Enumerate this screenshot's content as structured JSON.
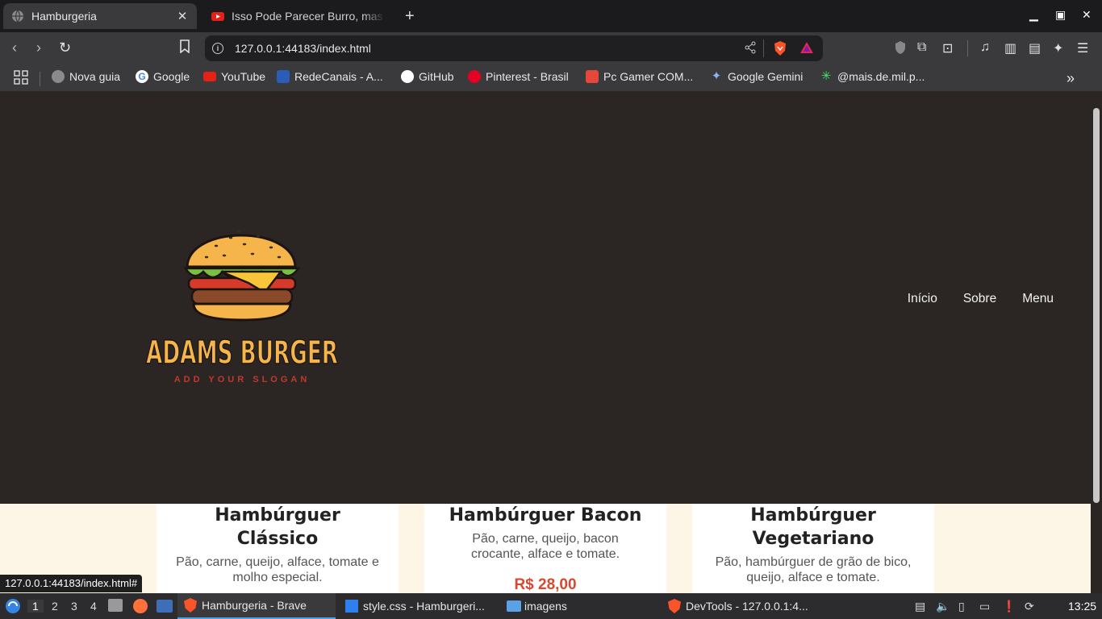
{
  "browser": {
    "tabs": [
      {
        "title": "Hamburgeria",
        "active": true
      },
      {
        "title": "Isso Pode Parecer Burro, mas v",
        "active": false
      }
    ],
    "new_tab": "+",
    "url": "127.0.0.1:44183/index.html",
    "bookmarks": [
      {
        "label": "Nova guia",
        "icon": "globe-icon"
      },
      {
        "label": "Google",
        "icon": "google-icon"
      },
      {
        "label": "YouTube",
        "icon": "youtube-icon"
      },
      {
        "label": "RedeCanais - A...",
        "icon": "redecanais-icon"
      },
      {
        "label": "GitHub",
        "icon": "github-icon"
      },
      {
        "label": "Pinterest - Brasil",
        "icon": "pinterest-icon"
      },
      {
        "label": "Pc Gamer COM...",
        "icon": "shop-icon"
      },
      {
        "label": "Google Gemini",
        "icon": "gemini-icon"
      },
      {
        "label": "@mais.de.mil.p...",
        "icon": "linktree-icon"
      }
    ],
    "status_url": "127.0.0.1:44183/index.html#"
  },
  "page": {
    "logo": {
      "brand": "ADAMS BURGER",
      "slogan": "ADD YOUR SLOGAN"
    },
    "nav": [
      "Início",
      "Sobre",
      "Menu"
    ],
    "cards": [
      {
        "title": "Hambúrguer Clássico",
        "desc": "Pão, carne, queijo, alface, tomate e molho especial.",
        "price": ""
      },
      {
        "title": "Hambúrguer Bacon",
        "desc": "Pão, carne, queijo, bacon crocante, alface e tomate.",
        "price": "R$ 28,00"
      },
      {
        "title": "Hambúrguer Vegetariano",
        "desc": "Pão, hambúrguer de grão de bico, queijo, alface e tomate.",
        "price": ""
      }
    ]
  },
  "taskbar": {
    "workspaces": [
      "1",
      "2",
      "3",
      "4"
    ],
    "windows": [
      {
        "label": "Hamburgeria - Brave",
        "active": true
      },
      {
        "label": "style.css - Hamburgeri...",
        "active": false
      },
      {
        "label": "imagens",
        "active": false
      },
      {
        "label": "DevTools - 127.0.0.1:4...",
        "active": false
      }
    ],
    "clock": "13:25"
  },
  "colors": {
    "hero_bg": "#2b2624",
    "page_bg": "#fdf6e6",
    "price": "#d94830",
    "logo_text": "#f6b54a"
  }
}
